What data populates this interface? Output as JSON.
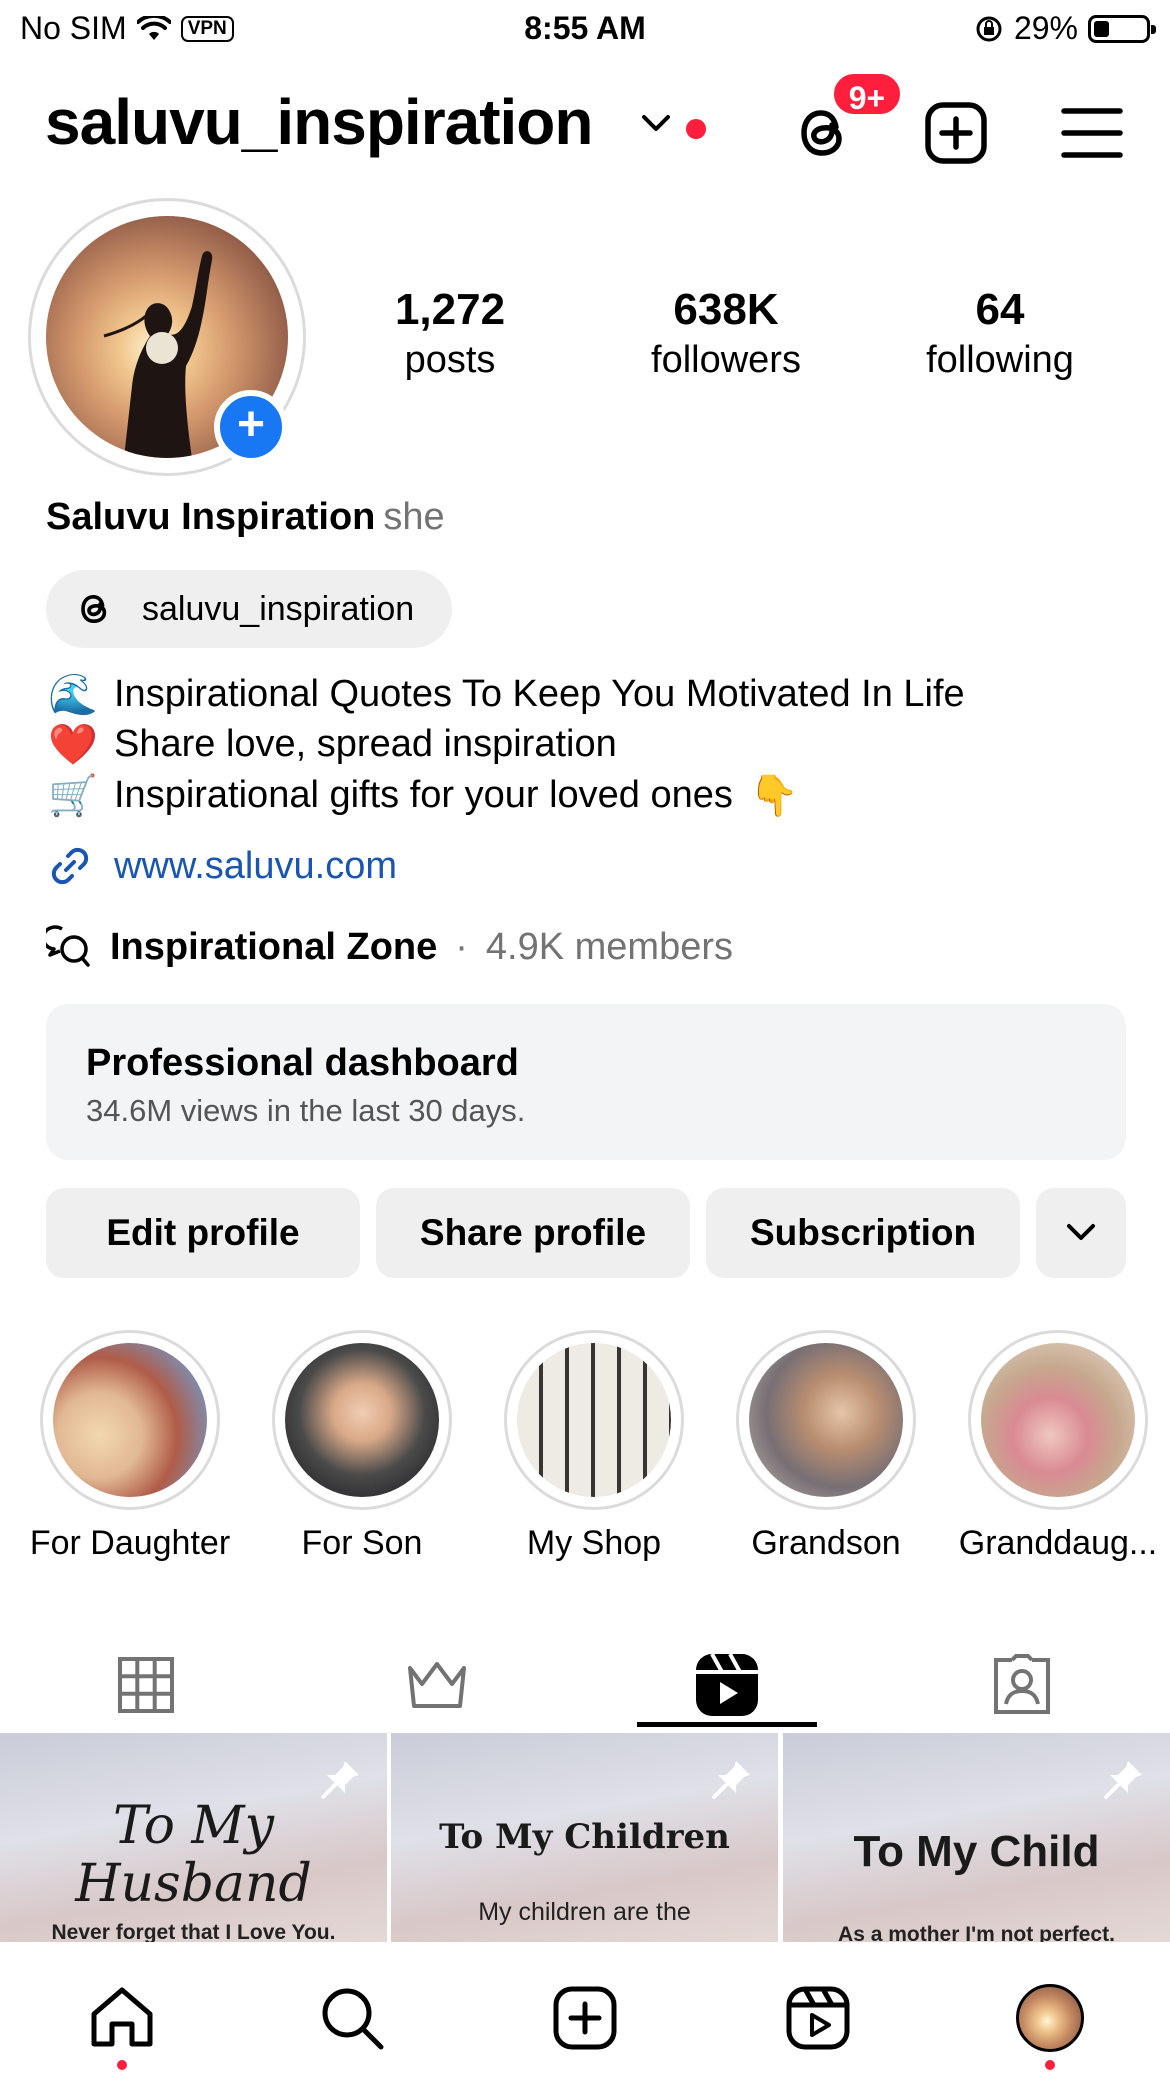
{
  "status_bar": {
    "carrier": "No SIM",
    "vpn": "VPN",
    "time": "8:55 AM",
    "battery": "29%",
    "battery_level": 0.29
  },
  "header": {
    "username": "saluvu_inspiration",
    "notifications_badge": "9+"
  },
  "stats": [
    {
      "value": "1,272",
      "label": "posts"
    },
    {
      "value": "638K",
      "label": "followers"
    },
    {
      "value": "64",
      "label": "following"
    }
  ],
  "profile": {
    "display_name": "Saluvu Inspiration",
    "pronouns": "she",
    "threads_handle": "saluvu_inspiration"
  },
  "bio": [
    {
      "emoji": "🌊",
      "text": "Inspirational Quotes To Keep You Motivated In Life"
    },
    {
      "emoji": "❤️",
      "text": "Share love, spread inspiration"
    },
    {
      "emoji": "🛒",
      "text": "Inspirational gifts for your loved ones",
      "trailing_emoji": "👇"
    }
  ],
  "link": "www.saluvu.com",
  "channel": {
    "name": "Inspirational Zone",
    "separator": "·",
    "members": "4.9K members"
  },
  "dashboard": {
    "title": "Professional dashboard",
    "subtitle": "34.6M views in the last 30 days."
  },
  "actions": {
    "edit": "Edit profile",
    "share": "Share profile",
    "subscription": "Subscription"
  },
  "highlights": [
    "For Daughter",
    "For Son",
    "My Shop",
    "Grandson",
    "Granddaug..."
  ],
  "tiles": [
    {
      "title": "To My Husband",
      "subtitle": "Never forget that I Love You."
    },
    {
      "title": "To My Children",
      "subtitle": "My children are the"
    },
    {
      "title": "To My Child",
      "subtitle": "As a mother I'm not perfect."
    }
  ],
  "colors": {
    "accent_blue": "#1877f2",
    "link_blue": "#1a56b0",
    "notification_red": "#ff1f3d",
    "button_gray": "#efefef"
  }
}
